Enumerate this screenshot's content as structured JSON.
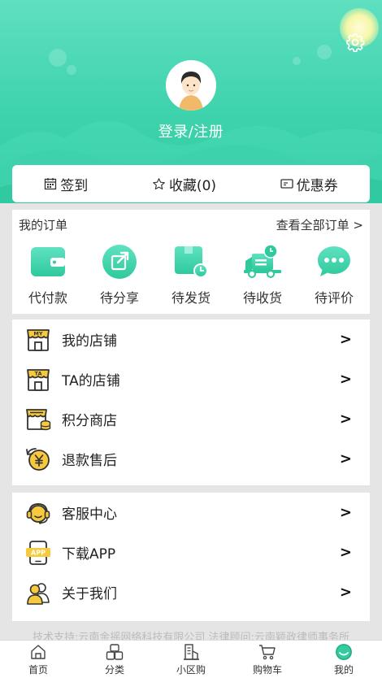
{
  "header": {
    "login_text": "登录/注册"
  },
  "quick": [
    {
      "label": "签到",
      "icon": "calendar-icon"
    },
    {
      "label": "收藏(0)",
      "icon": "star-icon"
    },
    {
      "label": "优惠券",
      "icon": "coupon-icon"
    }
  ],
  "orders": {
    "title": "我的订单",
    "view_all": "查看全部订单 >",
    "items": [
      {
        "label": "代付款",
        "icon": "wallet-icon"
      },
      {
        "label": "待分享",
        "icon": "share-icon"
      },
      {
        "label": "待发货",
        "icon": "package-icon"
      },
      {
        "label": "待收货",
        "icon": "truck-icon"
      },
      {
        "label": "待评价",
        "icon": "comment-icon"
      }
    ]
  },
  "menu1": [
    {
      "label": "我的店铺",
      "icon": "my-store-icon",
      "badge": "MY"
    },
    {
      "label": "TA的店铺",
      "icon": "ta-store-icon",
      "badge": "TA"
    },
    {
      "label": "积分商店",
      "icon": "points-store-icon"
    },
    {
      "label": "退款售后",
      "icon": "refund-icon"
    }
  ],
  "menu2": [
    {
      "label": "客服中心",
      "icon": "headset-icon"
    },
    {
      "label": "下载APP",
      "icon": "download-app-icon",
      "badge": "APP"
    },
    {
      "label": "关于我们",
      "icon": "about-us-icon"
    }
  ],
  "arrow": ">",
  "footer_text": "技术支持:云南金摇网络科技有限公司 法律顾问:云南颖政律师事务所",
  "tabbar": [
    {
      "label": "首页",
      "icon": "home-icon"
    },
    {
      "label": "分类",
      "icon": "category-icon"
    },
    {
      "label": "小区购",
      "icon": "community-icon"
    },
    {
      "label": "购物车",
      "icon": "cart-icon"
    },
    {
      "label": "我的",
      "icon": "profile-icon"
    }
  ],
  "colors": {
    "accent": "#33cc9f",
    "yellow": "#f7c93c"
  }
}
